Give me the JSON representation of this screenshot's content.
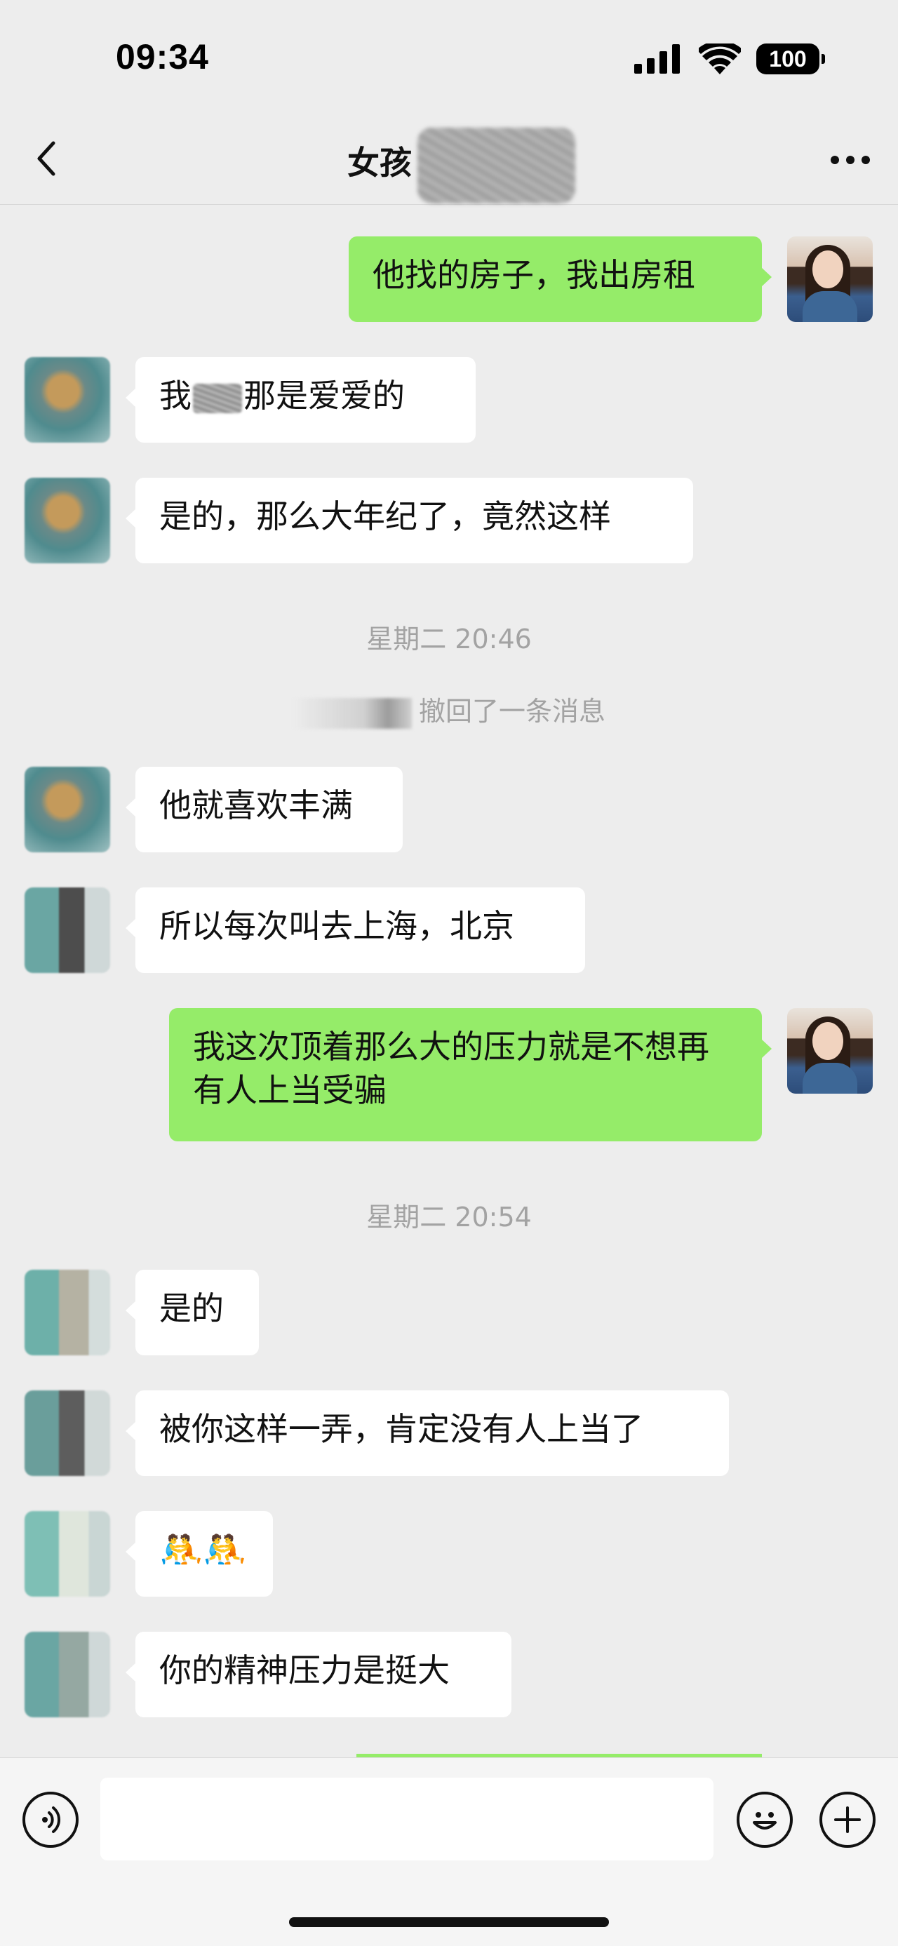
{
  "status_bar": {
    "time": "09:34",
    "battery": "100",
    "icons": [
      "signal-icon",
      "wifi-icon",
      "battery-icon"
    ]
  },
  "nav": {
    "title": "女孩",
    "back_icon": "chevron-left-icon",
    "more_icon": "more-icon"
  },
  "messages": [
    {
      "side": "out",
      "text": "他找的房子，我出房租"
    },
    {
      "side": "in",
      "text_before": "我",
      "text_after": "那是爱爱的"
    },
    {
      "side": "in",
      "text": "是的，那么大年纪了，竟然这样"
    },
    {
      "side": "in",
      "text": "他就喜欢丰满"
    },
    {
      "side": "in",
      "text": "所以每次叫去上海，北京"
    },
    {
      "side": "out",
      "text": "我这次顶着那么大的压力就是不想再有人上当受骗"
    },
    {
      "side": "in",
      "text": "是的"
    },
    {
      "side": "in",
      "text": "被你这样一弄，肯定没有人上当了"
    },
    {
      "side": "in",
      "text": "🤼🤼"
    },
    {
      "side": "in",
      "text": "你的精神压力是挺大"
    }
  ],
  "timestamps": [
    "星期二 20:46",
    "星期二 20:54"
  ],
  "system": {
    "recall_text": "撤回了一条消息"
  },
  "input_bar": {
    "voice_icon": "voice-icon",
    "emoji_icon": "emoji-icon",
    "plus_icon": "plus-icon",
    "placeholder": ""
  },
  "colors": {
    "background": "#ededed",
    "outgoing_bubble": "#95ec69",
    "incoming_bubble": "#ffffff",
    "timestamp_text": "#a3a3a3"
  }
}
